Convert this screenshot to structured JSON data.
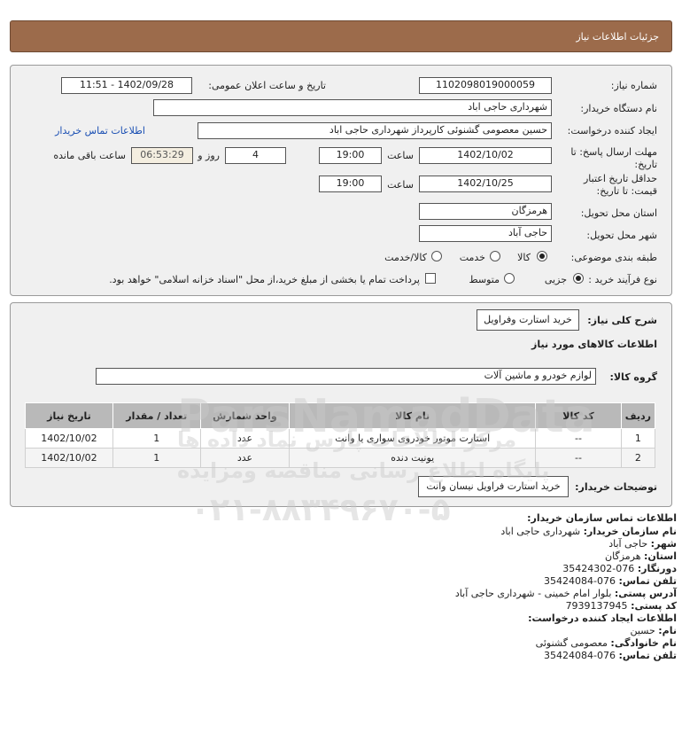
{
  "header": {
    "title": "جزئیات اطلاعات نیاز"
  },
  "form": {
    "need_number_label": "شماره نیاز:",
    "need_number": "1102098019000059",
    "announce_label": "تاریخ و ساعت اعلان عمومی:",
    "announce_value": "1402/09/28 - 11:51",
    "buyer_org_label": "نام دستگاه خریدار:",
    "buyer_org": "شهرداری حاجی اباد",
    "creator_label": "ایجاد کننده درخواست:",
    "creator": "حسین معصومی گشنوئی کارپرداز شهرداری حاجی اباد",
    "contact_link": "اطلاعات تماس خریدار",
    "reply_label_1": "مهلت ارسال پاسخ: تا",
    "reply_label_2": "تاریخ:",
    "reply_date": "1402/10/02",
    "time_label": "ساعت",
    "reply_time": "19:00",
    "days": "4",
    "day_and_label": "روز و",
    "remaining_time": "06:53:29",
    "remaining_label": "ساعت باقی مانده",
    "validity_label_1": "حداقل تاریخ اعتبار",
    "validity_label_2": "قیمت: تا تاریخ:",
    "validity_date": "1402/10/25",
    "validity_time": "19:00",
    "province_label": "استان محل تحویل:",
    "province": "هرمزگان",
    "city_label": "شهر محل تحویل:",
    "city": "حاجی آباد",
    "category_label": "طبقه بندی موضوعی:",
    "category_options": [
      "کالا",
      "خدمت",
      "کالا/خدمت"
    ],
    "purchase_label": "نوع فرآیند خرید :",
    "purchase_options": [
      "جزیی",
      "متوسط"
    ],
    "payment_note": "پرداخت تمام یا بخشی از مبلغ خرید،از محل \"اسناد خزانه اسلامی\" خواهد بود."
  },
  "need": {
    "desc_label": "شرح کلی نیاز:",
    "desc": "خرید استارت وفراویل",
    "goods_info_label": "اطلاعات کالاهای مورد نیاز",
    "group_label": "گروه کالا:",
    "group": "لوازم خودرو و ماشین آلات",
    "columns": [
      "ردیف",
      "کد کالا",
      "نام کالا",
      "واحد شمارش",
      "تعداد / مقدار",
      "تاریخ نیاز"
    ],
    "rows": [
      {
        "row": "1",
        "code": "--",
        "name": "استارت موتور خودروی سواری یا وانت",
        "unit": "عدد",
        "qty": "1",
        "date": "1402/10/02"
      },
      {
        "row": "2",
        "code": "--",
        "name": "یونیت دنده",
        "unit": "عدد",
        "qty": "1",
        "date": "1402/10/02"
      }
    ],
    "buyer_notes_label": "توضیحات خریدار:",
    "buyer_notes": "خرید استارت فراویل نیسان وانت"
  },
  "contact": {
    "org_title": "اطلاعات تماس سازمان خریدار:",
    "buyer_name_label": "نام سازمان خریدار:",
    "buyer_name": "شهرداری حاجی اباد",
    "city_label": "شهر:",
    "city": "حاجی آباد",
    "province_label": "استان:",
    "province": "هرمزگان",
    "fax_label": "دورنگار:",
    "fax": "076-35424302",
    "phone_label": "تلفن تماس:",
    "phone": "076-35424084",
    "address_label": "آدرس پستی:",
    "address": "بلوار امام خمینی - شهرداری حاجی آباد",
    "postal_label": "کد پستی:",
    "postal": "7939137945",
    "creator_title": "اطلاعات ایجاد کننده درخواست:",
    "first_name_label": "نام:",
    "first_name": "حسین",
    "last_name_label": "نام خانوادگی:",
    "last_name": "معصومی گشنوئی",
    "creator_phone_label": "تلفن تماس:",
    "creator_phone": "076-35424084"
  },
  "watermark": {
    "brand": "ParsNamadData",
    "line1": "مرکز اطلاعات پارس نماد داده ها",
    "line2": "پایگاه اطلاع رسانی مناقصه ومزایده",
    "phone": "۰۲۱-۸۸۳۴۹۶۷۰-۵"
  }
}
